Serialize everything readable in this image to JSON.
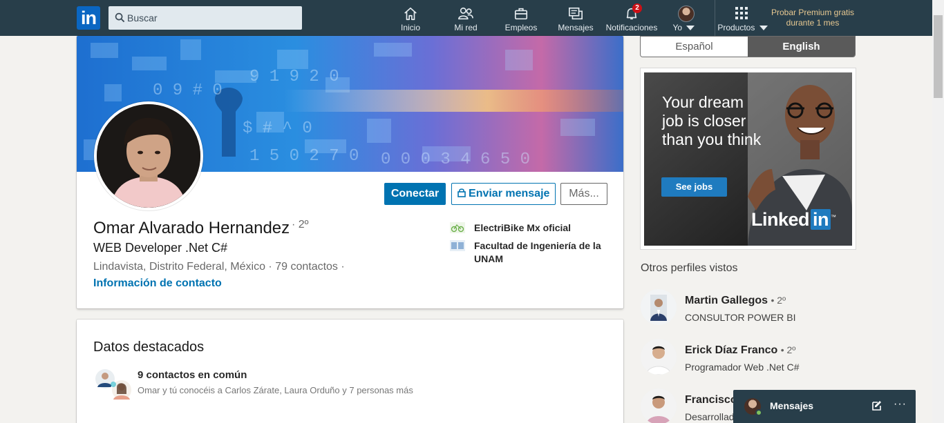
{
  "nav": {
    "logo": "in",
    "search_placeholder": "Buscar",
    "items": [
      {
        "label": "Inicio",
        "icon": "home-icon"
      },
      {
        "label": "Mi red",
        "icon": "people-icon"
      },
      {
        "label": "Empleos",
        "icon": "briefcase-icon"
      },
      {
        "label": "Mensajes",
        "icon": "messages-icon"
      },
      {
        "label": "Notificaciones",
        "icon": "bell-icon",
        "badge": "2"
      },
      {
        "label": "Yo",
        "icon": "avatar"
      },
      {
        "label": "Productos",
        "icon": "grid-icon"
      }
    ],
    "premium": "Probar Premium gratis durante 1 mes"
  },
  "profile": {
    "name": "Omar Alvarado Hernandez",
    "degree": "· 2º",
    "headline": "WEB Developer .Net C#",
    "location_line": "Lindavista, Distrito Federal, México  ·  79 contactos  ·",
    "contact_info": "Información de contacto",
    "buttons": {
      "connect": "Conectar",
      "message": "Enviar mensaje",
      "more": "Más..."
    },
    "experience": [
      {
        "label": "ElectriBike Mx oficial"
      },
      {
        "label": "Facultad de Ingeniería de la UNAM"
      }
    ]
  },
  "highlights": {
    "title": "Datos destacados",
    "shared": "9 contactos en común",
    "shared_sub": "Omar y tú conocéis a Carlos Zárate, Laura Orduño y 7 personas más"
  },
  "language": {
    "es": "Español",
    "en": "English",
    "selected": "English"
  },
  "ad": {
    "headline": "Your dream job is closer than you think",
    "button": "See jobs",
    "brand": "Linked",
    "brand_in": "in",
    "brand_mark": "™"
  },
  "others": {
    "title": "Otros perfiles vistos",
    "people": [
      {
        "name": "Martin Gallegos",
        "degree": "• 2º",
        "title": "CONSULTOR POWER BI"
      },
      {
        "name": "Erick Díaz Franco",
        "degree": "• 2º",
        "title": "Programador Web .Net C#"
      },
      {
        "name": "Francisco",
        "degree": "",
        "title": "Desarrollad"
      }
    ]
  },
  "messaging": {
    "label": "Mensajes",
    "more": "···"
  },
  "colors": {
    "nav_bg": "#283e4a",
    "brand_blue": "#0073b1",
    "premium_gold": "#e7c891",
    "badge_red": "#cc1016"
  }
}
